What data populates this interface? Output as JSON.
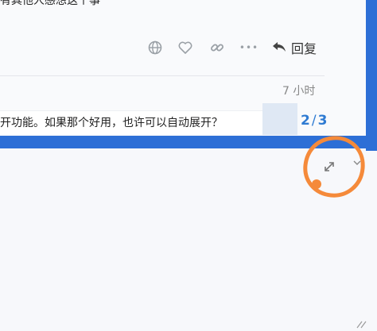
{
  "post": {
    "snippet_text": "有其他人感想这个事",
    "actions": [
      {
        "icon": "globe-icon",
        "glyph": "🌐"
      },
      {
        "icon": "heart-icon",
        "glyph": "♡"
      },
      {
        "icon": "link-icon",
        "glyph": "🔗"
      },
      {
        "icon": "more-icon",
        "glyph": "•••"
      }
    ],
    "reply_label": "回复",
    "reply_icon": "reply-icon"
  },
  "timeline": {
    "time_ago": "7 小时",
    "preview_text": "开功能。如果那个好用，也许可以自动展开？",
    "current": "2",
    "total": "3"
  },
  "controls": {
    "expand_icon": "expand-icon",
    "chevron_icon": "chevron-down-icon"
  },
  "colors": {
    "accent": "#2f7bd2",
    "frame_blue": "#2d6fd6",
    "annotation_orange": "#f58a3a"
  }
}
